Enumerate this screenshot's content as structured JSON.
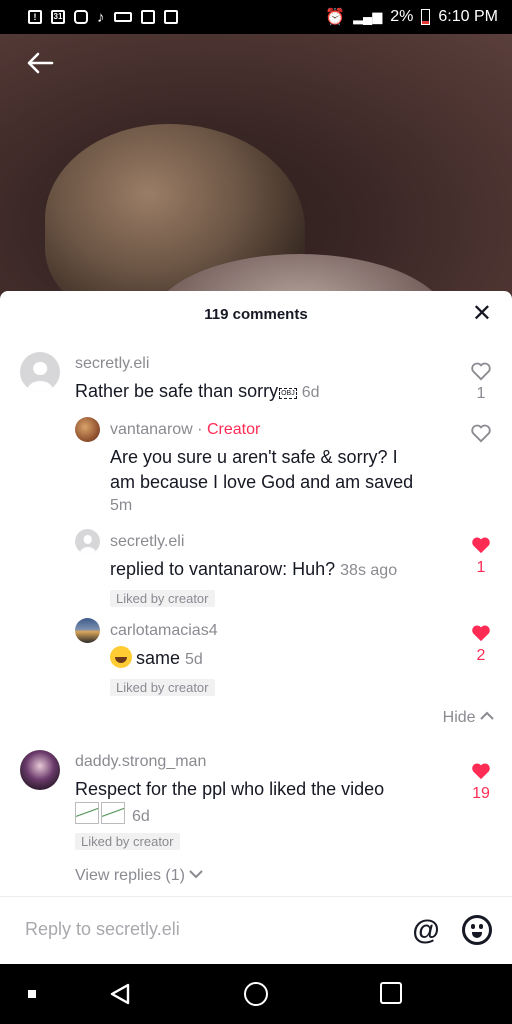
{
  "status_bar": {
    "left_icons": [
      "alert-icon",
      "calendar-icon",
      "instagram-icon",
      "tiktok-icon",
      "voicemail-icon",
      "gallery-icon",
      "clipboard-icon"
    ],
    "calendar_day": "31",
    "battery": "2%",
    "time": "6:10 PM"
  },
  "sheet": {
    "title": "119 comments"
  },
  "comments": [
    {
      "username": "secretly.eli",
      "text": "Rather be safe than sorry",
      "obj_placeholder": "OBJ",
      "time": "6d",
      "likes": "1",
      "liked": false
    },
    {
      "username": "vantanarow",
      "separator": "·",
      "creator_label": "Creator",
      "text_line1": "Are you sure u aren't safe & sorry? I",
      "text_line2": "am because I love God and am saved",
      "time": "5m",
      "liked": false
    },
    {
      "username": "secretly.eli",
      "text": "replied to vantanarow: Huh?",
      "time": "38s ago",
      "likes": "1",
      "liked": true,
      "badge": "Liked by creator"
    },
    {
      "username": "carlotamacias4",
      "text": "same",
      "time": "5d",
      "likes": "2",
      "liked": true,
      "badge": "Liked by creator"
    },
    {
      "username": "daddy.strong_man",
      "text": "Respect for the ppl who liked the video",
      "time": "6d",
      "likes": "19",
      "liked": true,
      "badge": "Liked by creator"
    }
  ],
  "hide_label": "Hide",
  "view_replies_label": "View replies (1)",
  "reply_bar": {
    "placeholder": "Reply to secretly.eli"
  },
  "colors": {
    "accent": "#fe2c55",
    "muted": "#8a8b91",
    "text": "#161823"
  }
}
